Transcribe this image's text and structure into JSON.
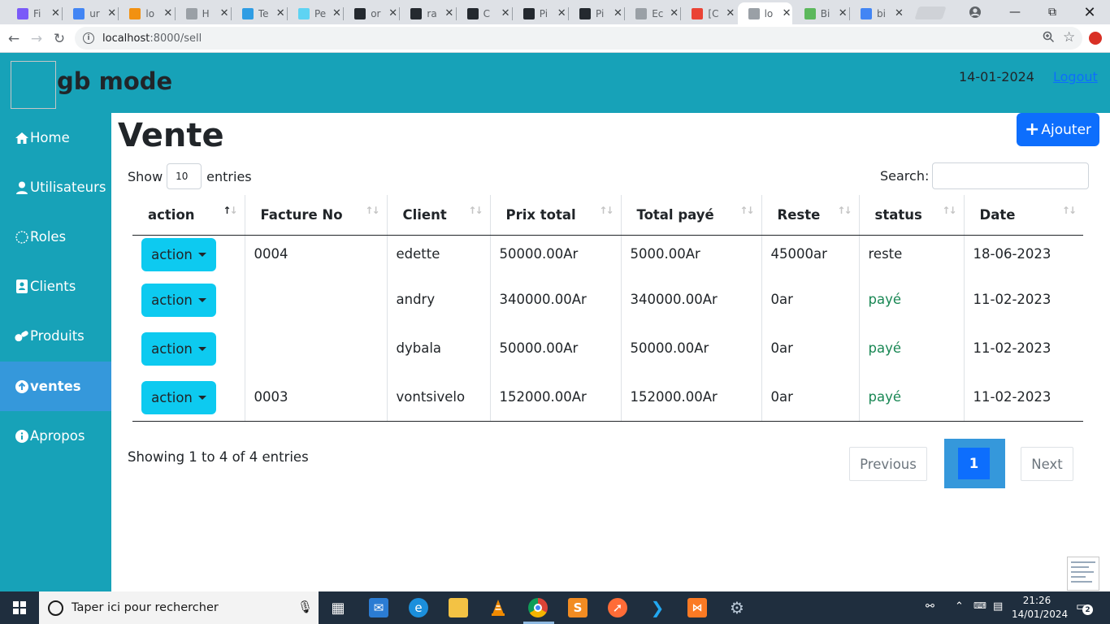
{
  "browser": {
    "tabs": [
      {
        "label": "Fi",
        "color": "#7a5af8"
      },
      {
        "label": "ur",
        "color": "#4285f4"
      },
      {
        "label": "lo",
        "color": "#f29111"
      },
      {
        "label": "H",
        "color": "#9aa0a6"
      },
      {
        "label": "Te",
        "color": "#2f9de4"
      },
      {
        "label": "Pe",
        "color": "#5ed3f3"
      },
      {
        "label": "or",
        "color": "#24292f"
      },
      {
        "label": "ra",
        "color": "#24292f"
      },
      {
        "label": "C",
        "color": "#24292f"
      },
      {
        "label": "Pi",
        "color": "#24292f"
      },
      {
        "label": "Pi",
        "color": "#24292f"
      },
      {
        "label": "Ec",
        "color": "#9aa0a6"
      },
      {
        "label": "[C",
        "color": "#ea4335"
      },
      {
        "label": "lo",
        "color": "#9aa0a6",
        "active": true
      },
      {
        "label": "Bi",
        "color": "#5cb85c"
      },
      {
        "label": "bi",
        "color": "#4285f4"
      }
    ],
    "url_host": "localhost",
    "url_path": ":8000/sell"
  },
  "header": {
    "brand": "gb mode",
    "date": "14-01-2024",
    "logout": "Logout"
  },
  "sidebar": {
    "items": [
      {
        "label": "Home",
        "icon": "home-icon"
      },
      {
        "label": "Utilisateurs",
        "icon": "user-icon"
      },
      {
        "label": "Roles",
        "icon": "role-icon"
      },
      {
        "label": "Clients",
        "icon": "contact-card-icon"
      },
      {
        "label": "Produits",
        "icon": "pills-icon"
      },
      {
        "label": "ventes",
        "icon": "arrow-up-circle-icon",
        "active": true
      },
      {
        "label": "Apropos",
        "icon": "info-icon"
      }
    ]
  },
  "main": {
    "title": "Vente",
    "add_label": "Ajouter",
    "show_label": "Show",
    "page_length": "10",
    "entries_label": "entries",
    "search_label": "Search:",
    "columns": [
      "action",
      "Facture No",
      "Client",
      "Prix total",
      "Total payé",
      "Reste",
      "status",
      "Date"
    ],
    "action_label": "action",
    "rows": [
      {
        "facture": "0004",
        "client": "edette",
        "prix_total": "50000.00Ar",
        "total_paye": "5000.00Ar",
        "reste": "45000ar",
        "status": "reste",
        "date": "18-06-2023"
      },
      {
        "facture": "",
        "client": "andry",
        "prix_total": "340000.00Ar",
        "total_paye": "340000.00Ar",
        "reste": "0ar",
        "status": "payé",
        "date": "11-02-2023"
      },
      {
        "facture": "",
        "client": "dybala",
        "prix_total": "50000.00Ar",
        "total_paye": "50000.00Ar",
        "reste": "0ar",
        "status": "payé",
        "date": "11-02-2023"
      },
      {
        "facture": "0003",
        "client": "vontsivelo",
        "prix_total": "152000.00Ar",
        "total_paye": "152000.00Ar",
        "reste": "0ar",
        "status": "payé",
        "date": "11-02-2023"
      }
    ],
    "info": "Showing 1 to 4 of 4 entries",
    "pagination": {
      "previous": "Previous",
      "current": "1",
      "next": "Next"
    }
  },
  "taskbar": {
    "search_placeholder": "Taper ici pour rechercher",
    "time": "21:26",
    "date": "14/01/2024",
    "notifications": "2"
  },
  "colors": {
    "teal": "#17a2b8",
    "active_nav": "#3598db",
    "primary": "#0d6efd",
    "info_button": "#0dcaf0",
    "paid_green": "#198754"
  }
}
